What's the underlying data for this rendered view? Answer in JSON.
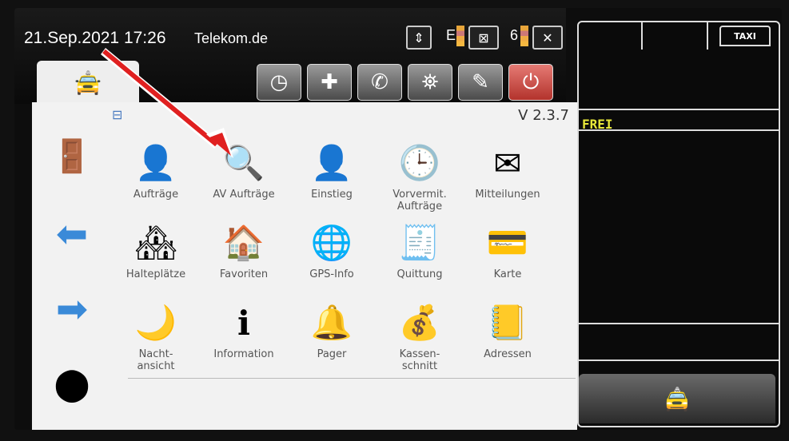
{
  "status": {
    "datetime": "21.Sep.2021 17:26",
    "operator": "Telekom.de",
    "gps_letter": "E",
    "count": "6"
  },
  "toolbar": {
    "icons": [
      "clock-icon",
      "compass-icon",
      "phone-icon",
      "satellite-icon",
      "pen-icon",
      "power-icon"
    ]
  },
  "panel": {
    "version": "V 2.3.7",
    "grid": [
      {
        "name": "auftraege",
        "icon": "👤",
        "label": "Aufträge"
      },
      {
        "name": "av-auftraege",
        "icon": "🔍",
        "label": "AV Aufträge"
      },
      {
        "name": "einstieg",
        "icon": "👤",
        "label": "Einstieg"
      },
      {
        "name": "vorvermit-auftraege",
        "icon": "🕒",
        "label": "Vorvermit.\nAufträge"
      },
      {
        "name": "mitteilungen",
        "icon": "✉",
        "label": "Mitteilungen"
      },
      {
        "name": "halteplaetze",
        "icon": "🏘",
        "label": "Halteplätze"
      },
      {
        "name": "favoriten",
        "icon": "🏠",
        "label": "Favoriten"
      },
      {
        "name": "gps-info",
        "icon": "🌐",
        "label": "GPS-Info"
      },
      {
        "name": "quittung",
        "icon": "🧾",
        "label": "Quittung"
      },
      {
        "name": "karte",
        "icon": "💳",
        "label": "Karte"
      },
      {
        "name": "nachtansicht",
        "icon": "🌙",
        "label": "Nacht-\nansicht"
      },
      {
        "name": "information",
        "icon": "ℹ",
        "label": "Information"
      },
      {
        "name": "pager",
        "icon": "🔔",
        "label": "Pager"
      },
      {
        "name": "kassenschnitt",
        "icon": "💰",
        "label": "Kassen-\nschnitt"
      },
      {
        "name": "adressen",
        "icon": "📒",
        "label": "Adressen"
      }
    ]
  },
  "right": {
    "taxi_label": "TAXI",
    "status_text": "FREI"
  },
  "colors": {
    "arrow": "#e02020",
    "frei": "#e8e83a"
  }
}
